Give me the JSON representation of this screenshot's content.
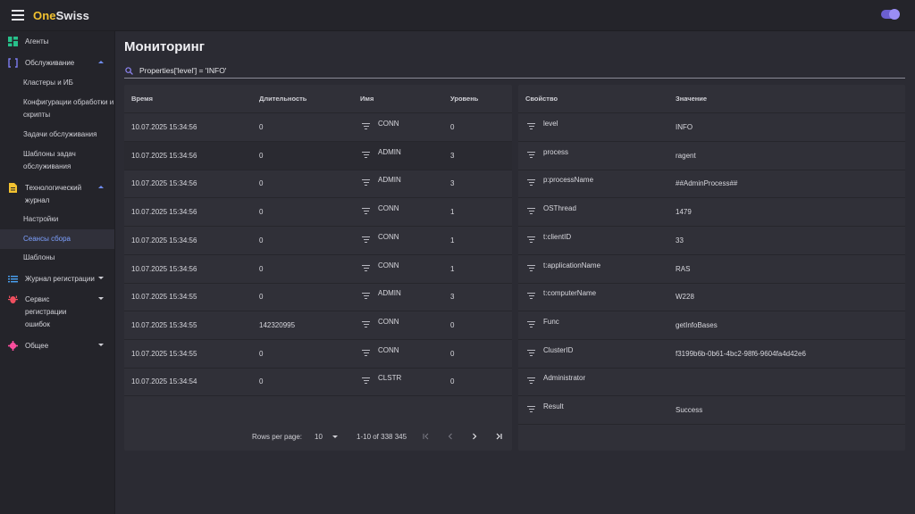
{
  "app": {
    "logo_a": "One",
    "logo_b": "Swiss"
  },
  "sidebar": {
    "agents": "Агенты",
    "service": "Обслуживание",
    "service_items": [
      "Кластеры и ИБ",
      "Конфигурации обработки и скрипты",
      "Задачи обслуживания",
      "Шаблоны задач обслуживания"
    ],
    "techlog": "Технологический журнал",
    "techlog_items": [
      "Настройки",
      "Сеансы сбора",
      "Шаблоны"
    ],
    "reglog": "Журнал регистрации",
    "errorservice": "Сервис регистрации ошибок",
    "common": "Общее"
  },
  "page": {
    "title": "Мониторинг"
  },
  "search": {
    "value": "Properties['level'] = 'INFO'"
  },
  "left_table": {
    "headers": [
      "Время",
      "Длительность",
      "Имя",
      "Уровень"
    ],
    "rows": [
      {
        "time": "10.07.2025 15:34:56",
        "duration": "0",
        "name": "CONN",
        "level": "0"
      },
      {
        "time": "10.07.2025 15:34:56",
        "duration": "0",
        "name": "ADMIN",
        "level": "3"
      },
      {
        "time": "10.07.2025 15:34:56",
        "duration": "0",
        "name": "ADMIN",
        "level": "3"
      },
      {
        "time": "10.07.2025 15:34:56",
        "duration": "0",
        "name": "CONN",
        "level": "1"
      },
      {
        "time": "10.07.2025 15:34:56",
        "duration": "0",
        "name": "CONN",
        "level": "1"
      },
      {
        "time": "10.07.2025 15:34:56",
        "duration": "0",
        "name": "CONN",
        "level": "1"
      },
      {
        "time": "10.07.2025 15:34:55",
        "duration": "0",
        "name": "ADMIN",
        "level": "3"
      },
      {
        "time": "10.07.2025 15:34:55",
        "duration": "142320995",
        "name": "CONN",
        "level": "0"
      },
      {
        "time": "10.07.2025 15:34:55",
        "duration": "0",
        "name": "CONN",
        "level": "0"
      },
      {
        "time": "10.07.2025 15:34:54",
        "duration": "0",
        "name": "CLSTR",
        "level": "0"
      }
    ],
    "footer": {
      "rows_per_page_label": "Rows per page:",
      "rows_per_page": "10",
      "range": "1-10 of 338 345"
    }
  },
  "right_table": {
    "headers": [
      "Свойство",
      "Значение"
    ],
    "rows": [
      {
        "prop": "level",
        "value": "INFO"
      },
      {
        "prop": "process",
        "value": "ragent"
      },
      {
        "prop": "p:processName",
        "value": "##AdminProcess##"
      },
      {
        "prop": "OSThread",
        "value": "1479"
      },
      {
        "prop": "t:clientID",
        "value": "33"
      },
      {
        "prop": "t:applicationName",
        "value": "RAS"
      },
      {
        "prop": "t:computerName",
        "value": "W228"
      },
      {
        "prop": "Func",
        "value": "getInfoBases"
      },
      {
        "prop": "ClusterID",
        "value": "f3199b6b-0b61-4bc2-98f6-9604fa4d42e6"
      },
      {
        "prop": "Administrator",
        "value": ""
      },
      {
        "prop": "Result",
        "value": "Success"
      }
    ]
  },
  "colors": {
    "accent": "#6b5fd0",
    "active_link": "#7da0ff",
    "logo_yellow": "#f2c230"
  }
}
